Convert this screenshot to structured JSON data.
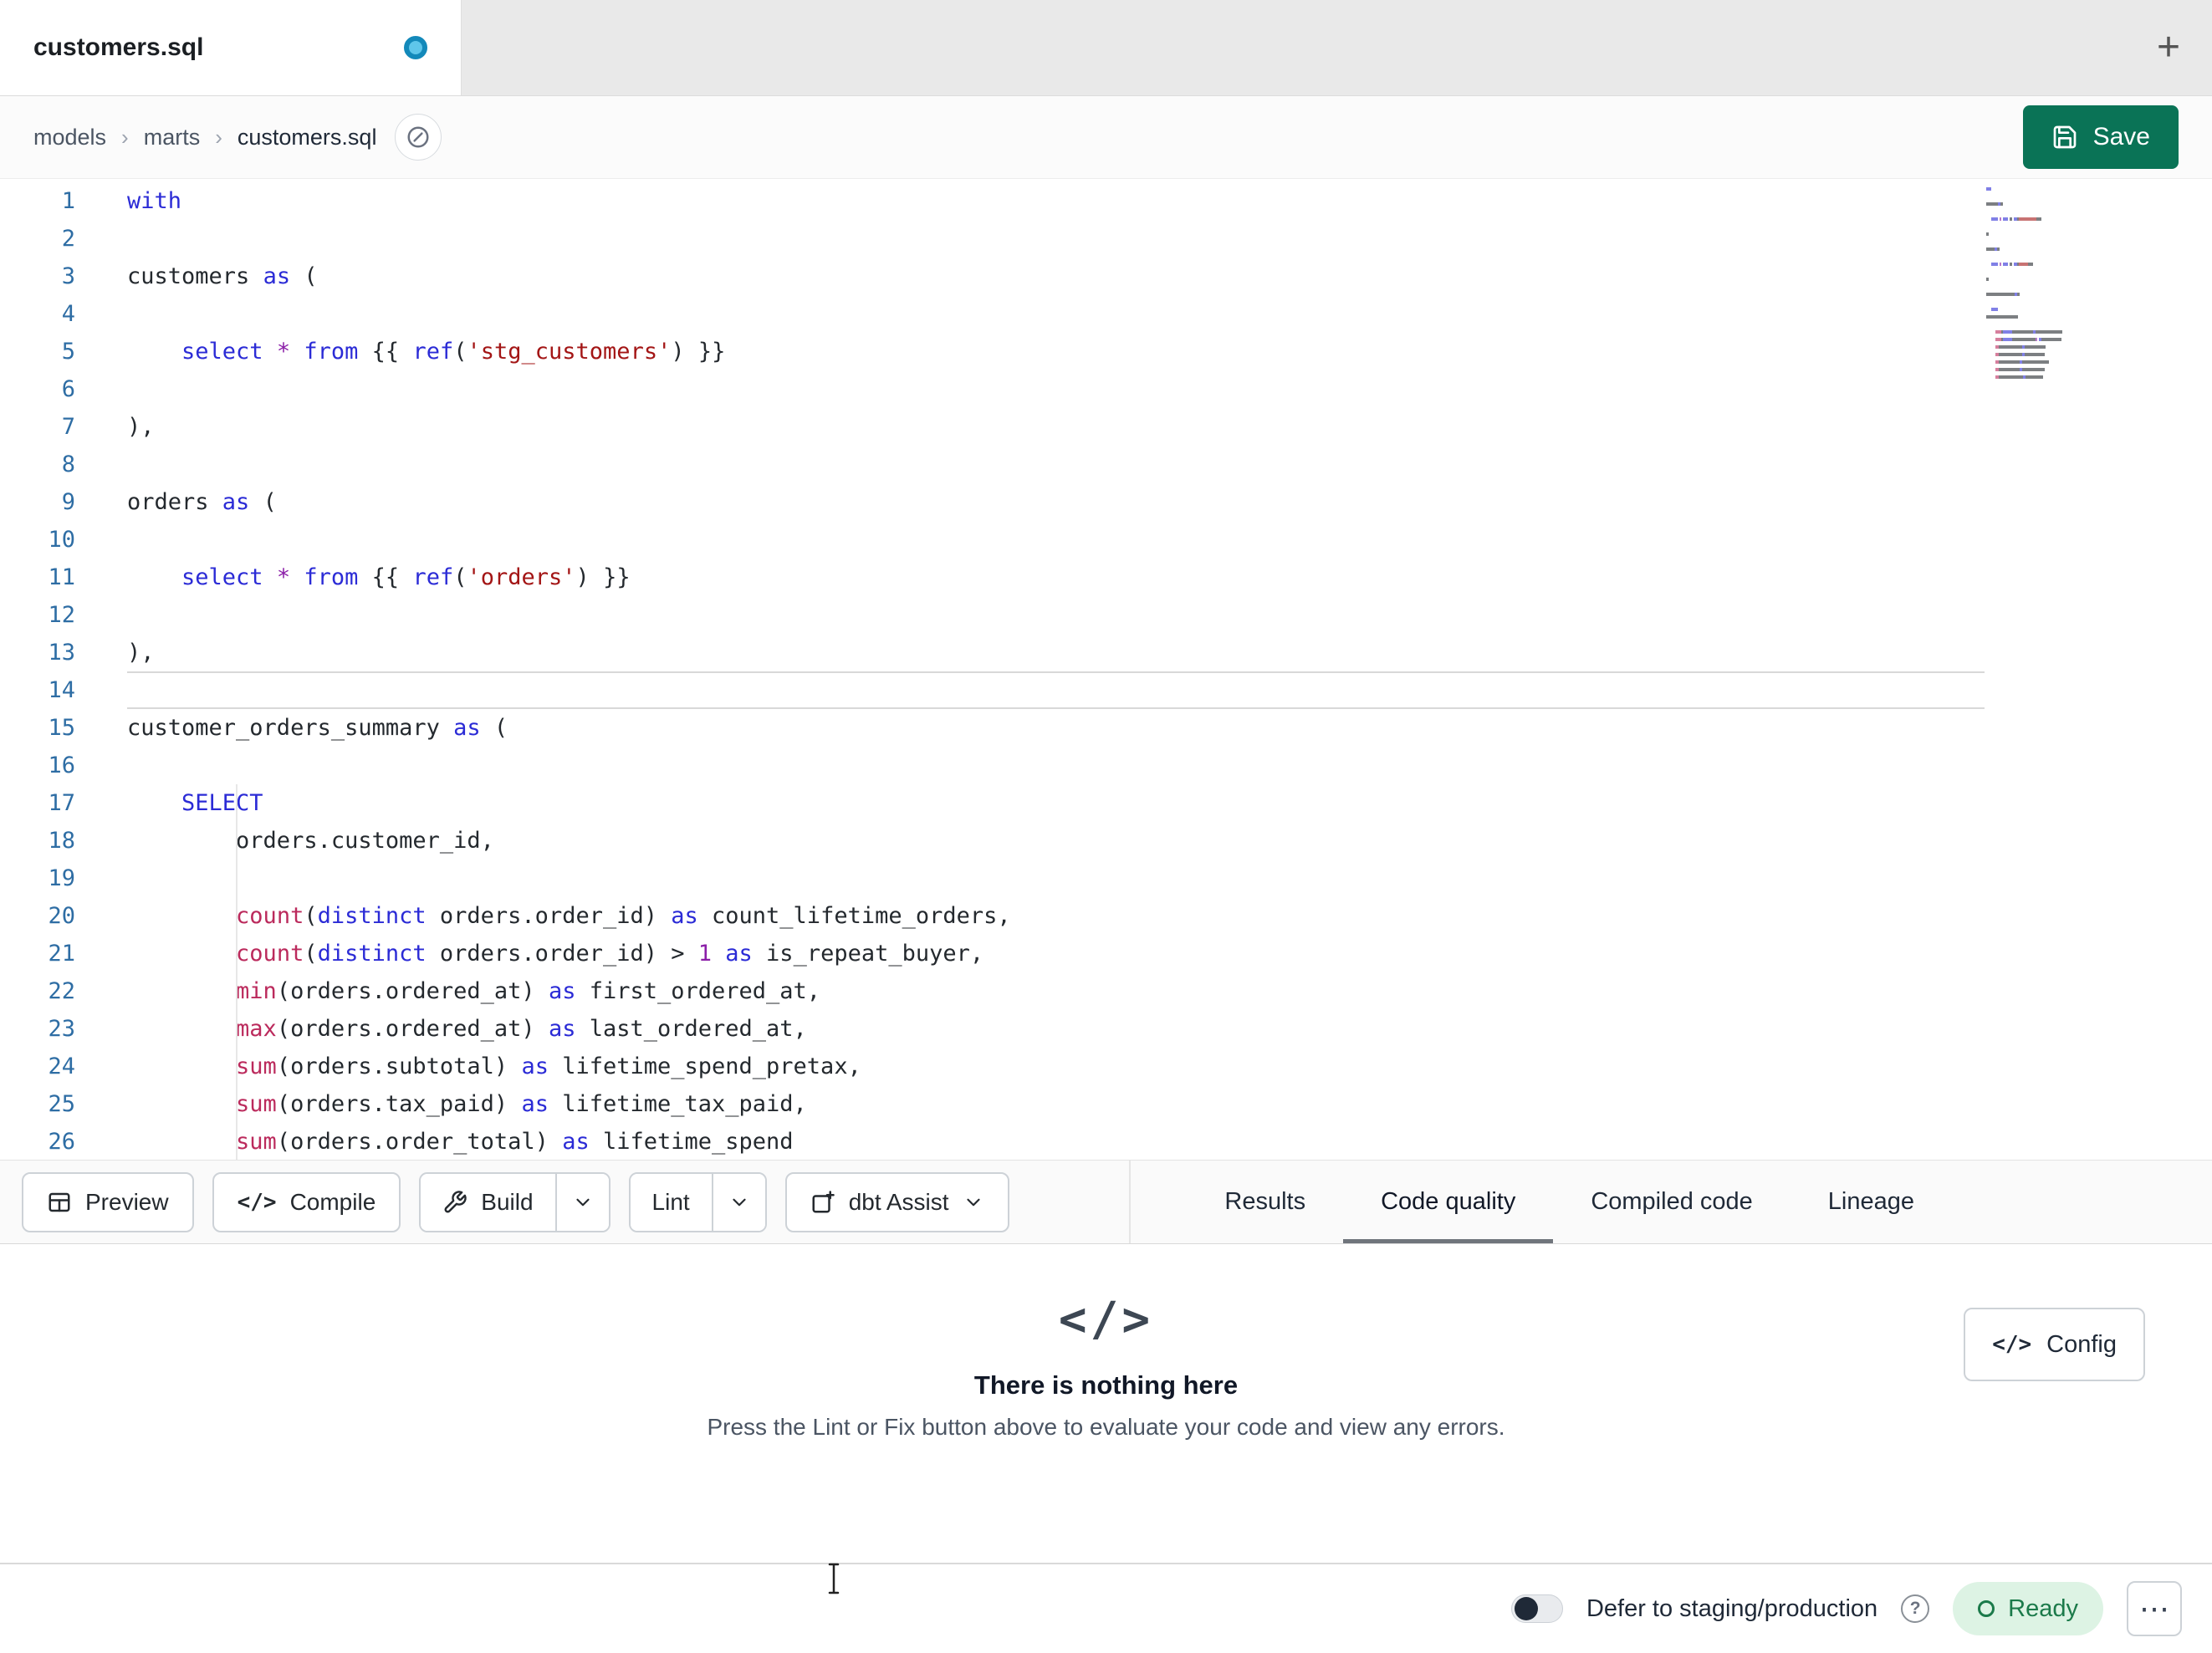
{
  "tab_bar": {
    "tabs": [
      {
        "label": "customers.sql",
        "modified": true
      }
    ]
  },
  "breadcrumb": {
    "items": [
      "models",
      "marts",
      "customers.sql"
    ],
    "separator": "›"
  },
  "save_button": {
    "label": "Save"
  },
  "icons": {
    "new_tab": "+",
    "code": "</>",
    "config_code": "</>",
    "ellipsis": "⋯",
    "help": "?"
  },
  "editor": {
    "active_line": 14,
    "lines": [
      [
        [
          "k",
          "with"
        ]
      ],
      [],
      [
        [
          "p",
          "customers "
        ],
        [
          "k",
          "as"
        ],
        [
          "p",
          " ("
        ]
      ],
      [],
      [
        [
          "p",
          "    "
        ],
        [
          "k",
          "select"
        ],
        [
          "p",
          " "
        ],
        [
          "o",
          "*"
        ],
        [
          "p",
          " "
        ],
        [
          "k",
          "from"
        ],
        [
          "p",
          " "
        ],
        [
          "j",
          "{{"
        ],
        [
          "p",
          " "
        ],
        [
          "k",
          "ref"
        ],
        [
          "p",
          "("
        ],
        [
          "s",
          "'stg_customers'"
        ],
        [
          "p",
          ") "
        ],
        [
          "j",
          "}}"
        ]
      ],
      [],
      [
        [
          "p",
          "),"
        ]
      ],
      [],
      [
        [
          "p",
          "orders "
        ],
        [
          "k",
          "as"
        ],
        [
          "p",
          " ("
        ]
      ],
      [],
      [
        [
          "p",
          "    "
        ],
        [
          "k",
          "select"
        ],
        [
          "p",
          " "
        ],
        [
          "o",
          "*"
        ],
        [
          "p",
          " "
        ],
        [
          "k",
          "from"
        ],
        [
          "p",
          " "
        ],
        [
          "j",
          "{{"
        ],
        [
          "p",
          " "
        ],
        [
          "k",
          "ref"
        ],
        [
          "p",
          "("
        ],
        [
          "s",
          "'orders'"
        ],
        [
          "p",
          ") "
        ],
        [
          "j",
          "}}"
        ]
      ],
      [],
      [
        [
          "p",
          "),"
        ]
      ],
      [],
      [
        [
          "p",
          "customer_orders_summary "
        ],
        [
          "k",
          "as"
        ],
        [
          "p",
          " ("
        ]
      ],
      [],
      [
        [
          "p",
          "    "
        ],
        [
          "k",
          "SELECT"
        ]
      ],
      [
        [
          "p",
          "        orders.customer_id,"
        ]
      ],
      [],
      [
        [
          "p",
          "        "
        ],
        [
          "f",
          "count"
        ],
        [
          "p",
          "("
        ],
        [
          "k",
          "distinct"
        ],
        [
          "p",
          " orders.order_id) "
        ],
        [
          "k",
          "as"
        ],
        [
          "p",
          " count_lifetime_orders,"
        ]
      ],
      [
        [
          "p",
          "        "
        ],
        [
          "f",
          "count"
        ],
        [
          "p",
          "("
        ],
        [
          "k",
          "distinct"
        ],
        [
          "p",
          " orders.order_id) > "
        ],
        [
          "n",
          "1"
        ],
        [
          "p",
          " "
        ],
        [
          "k",
          "as"
        ],
        [
          "p",
          " is_repeat_buyer,"
        ]
      ],
      [
        [
          "p",
          "        "
        ],
        [
          "f",
          "min"
        ],
        [
          "p",
          "(orders.ordered_at) "
        ],
        [
          "k",
          "as"
        ],
        [
          "p",
          " first_ordered_at,"
        ]
      ],
      [
        [
          "p",
          "        "
        ],
        [
          "f",
          "max"
        ],
        [
          "p",
          "(orders.ordered_at) "
        ],
        [
          "k",
          "as"
        ],
        [
          "p",
          " last_ordered_at,"
        ]
      ],
      [
        [
          "p",
          "        "
        ],
        [
          "f",
          "sum"
        ],
        [
          "p",
          "(orders.subtotal) "
        ],
        [
          "k",
          "as"
        ],
        [
          "p",
          " lifetime_spend_pretax,"
        ]
      ],
      [
        [
          "p",
          "        "
        ],
        [
          "f",
          "sum"
        ],
        [
          "p",
          "(orders.tax_paid) "
        ],
        [
          "k",
          "as"
        ],
        [
          "p",
          " lifetime_tax_paid,"
        ]
      ],
      [
        [
          "p",
          "        "
        ],
        [
          "f",
          "sum"
        ],
        [
          "p",
          "(orders.order_total) "
        ],
        [
          "k",
          "as"
        ],
        [
          "p",
          " lifetime_spend"
        ]
      ]
    ]
  },
  "toolbar": {
    "preview_label": "Preview",
    "compile_label": "Compile",
    "build_label": "Build",
    "lint_label": "Lint",
    "dbt_assist_label": "dbt Assist"
  },
  "panel_tabs": [
    {
      "label": "Results",
      "active": false
    },
    {
      "label": "Code quality",
      "active": true
    },
    {
      "label": "Compiled code",
      "active": false
    },
    {
      "label": "Lineage",
      "active": false
    }
  ],
  "empty_state": {
    "icon": "</>",
    "title": "There is nothing here",
    "description": "Press the Lint or Fix button above to evaluate your code and view any errors."
  },
  "config_button": {
    "label": "Config"
  },
  "status_bar": {
    "defer_label": "Defer to staging/production",
    "ready_label": "Ready",
    "toggle_on": false
  },
  "colors": {
    "accent_save": "#0a7356",
    "tab_dot": "#5fc6ea",
    "tab_dot_ring": "#1389ba",
    "line_number": "#2e6da4",
    "active_tab_underline": "#70757c",
    "ready_bg": "#ddf3e4",
    "ready_text": "#1b7a4a",
    "tokens": {
      "k": "#2b2bd6",
      "f": "#bb2a5c",
      "s": "#a31515",
      "n": "#8b1fa8",
      "o": "#8b1fa8",
      "j": "#24292e",
      "p": "#24292e"
    }
  }
}
